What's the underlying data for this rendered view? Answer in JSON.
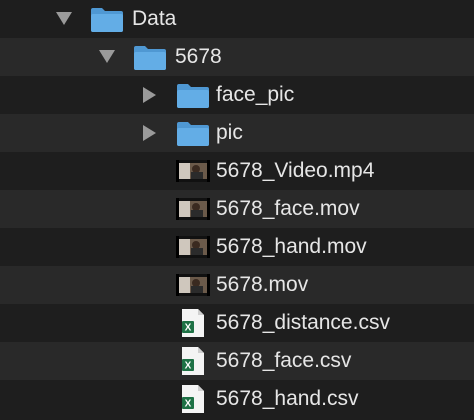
{
  "colors": {
    "background": "#1e1e1e",
    "row_alt": "#292929",
    "text": "#e6e6e6",
    "disclosure": "#9a9a9a",
    "folder": "#5aa6e0"
  },
  "tree": [
    {
      "label": "Data",
      "type": "folder",
      "expanded": true,
      "icon": "folder-icon"
    },
    {
      "label": "5678",
      "type": "folder",
      "expanded": true,
      "icon": "folder-icon"
    },
    {
      "label": "face_pic",
      "type": "folder",
      "expanded": false,
      "icon": "folder-icon"
    },
    {
      "label": "pic",
      "type": "folder",
      "expanded": false,
      "icon": "folder-icon"
    },
    {
      "label": "5678_Video.mp4",
      "type": "video",
      "icon": "video-thumbnail-icon"
    },
    {
      "label": "5678_face.mov",
      "type": "video",
      "icon": "video-thumbnail-icon"
    },
    {
      "label": "5678_hand.mov",
      "type": "video",
      "icon": "video-thumbnail-icon"
    },
    {
      "label": "5678.mov",
      "type": "video",
      "icon": "video-thumbnail-icon"
    },
    {
      "label": "5678_distance.csv",
      "type": "csv",
      "icon": "excel-csv-icon"
    },
    {
      "label": "5678_face.csv",
      "type": "csv",
      "icon": "excel-csv-icon"
    },
    {
      "label": "5678_hand.csv",
      "type": "csv",
      "icon": "excel-csv-icon"
    }
  ]
}
